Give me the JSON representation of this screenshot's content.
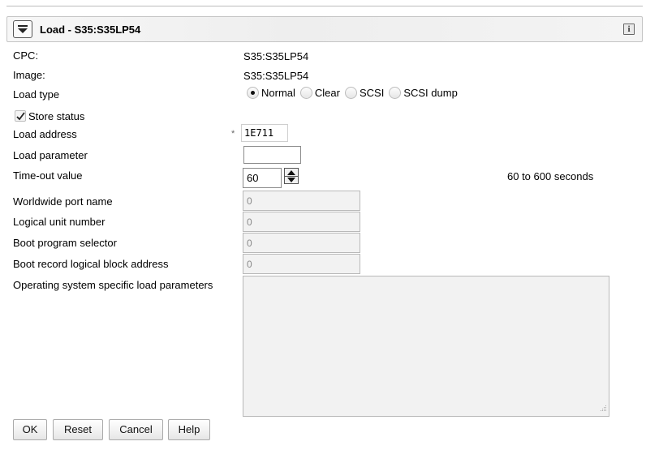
{
  "window": {
    "title": "Load - S35:S35LP54"
  },
  "fields": {
    "cpc": {
      "label": "CPC:",
      "value": "S35:S35LP54"
    },
    "image": {
      "label": "Image:",
      "value": "S35:S35LP54"
    },
    "load_type": {
      "label": "Load type",
      "options": [
        "Normal",
        "Clear",
        "SCSI",
        "SCSI dump"
      ],
      "selected": "Normal"
    },
    "store_status": {
      "label": "Store status",
      "checked": true
    },
    "load_address": {
      "label": "Load address",
      "required_marker": "*",
      "value": "1E711"
    },
    "load_parameter": {
      "label": "Load parameter",
      "value": ""
    },
    "timeout": {
      "label": "Time-out value",
      "value": "60",
      "range_text": "60 to 600 seconds"
    },
    "wwpn": {
      "label": "Worldwide port name",
      "value": "0"
    },
    "lun": {
      "label": "Logical unit number",
      "value": "0"
    },
    "boot_program_selector": {
      "label": "Boot program selector",
      "value": "0"
    },
    "boot_record_lba": {
      "label": "Boot record logical block address",
      "value": "0"
    },
    "os_load_params": {
      "label": "Operating system specific load parameters",
      "value": ""
    }
  },
  "buttons": {
    "ok": "OK",
    "reset": "Reset",
    "cancel": "Cancel",
    "help": "Help"
  },
  "icons": {
    "collapse": "chevron-down-icon",
    "info": "info-icon",
    "checkmark": "checkmark-icon",
    "spinner_up": "triangle-up-icon",
    "spinner_down": "triangle-down-icon",
    "resize": "resize-grip-icon"
  },
  "info_glyph": "i"
}
